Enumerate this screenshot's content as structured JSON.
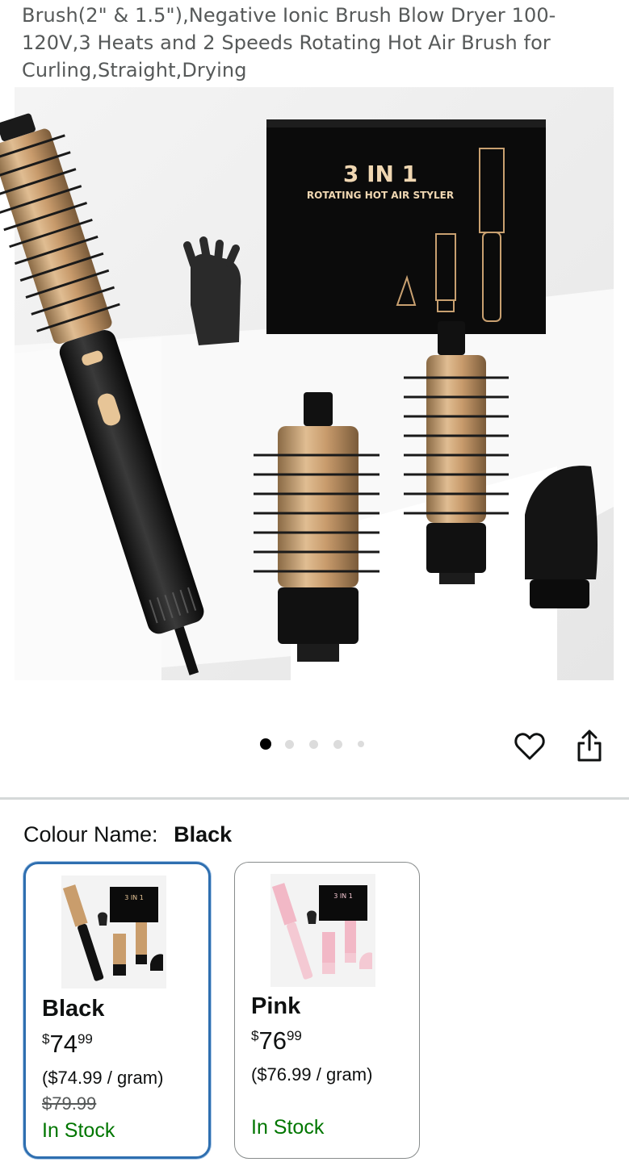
{
  "product": {
    "title": "Brush(2\" & 1.5\"),Negative Ionic Brush Blow Dryer 100-120V,3 Heats and 2 Speeds Rotating Hot Air Brush for Curling,Straight,Drying"
  },
  "hero_image": {
    "box_title": "3 IN 1",
    "box_subtitle": "ROTATING HOT AIR STYLER",
    "carousel_count": 5,
    "carousel_active": 1
  },
  "actions": {
    "wishlist_icon": "heart-icon",
    "share_icon": "share-icon"
  },
  "variation": {
    "label": "Colour Name:",
    "selected_value": "Black",
    "options": [
      {
        "name": "Black",
        "price_symbol": "$",
        "price_whole": "74",
        "price_fraction": "99",
        "unit_price": "($74.99 / gram)",
        "list_price": "$79.99",
        "availability": "In Stock",
        "thumb_box_text": "3 IN 1",
        "selected": true
      },
      {
        "name": "Pink",
        "price_symbol": "$",
        "price_whole": "76",
        "price_fraction": "99",
        "unit_price": "($76.99 / gram)",
        "availability": "In Stock",
        "thumb_box_text": "3 IN 1",
        "selected": false
      }
    ]
  },
  "colors": {
    "accent_selected_border": "#2f6fb0",
    "in_stock": "#007600",
    "muted_text": "#565959"
  }
}
